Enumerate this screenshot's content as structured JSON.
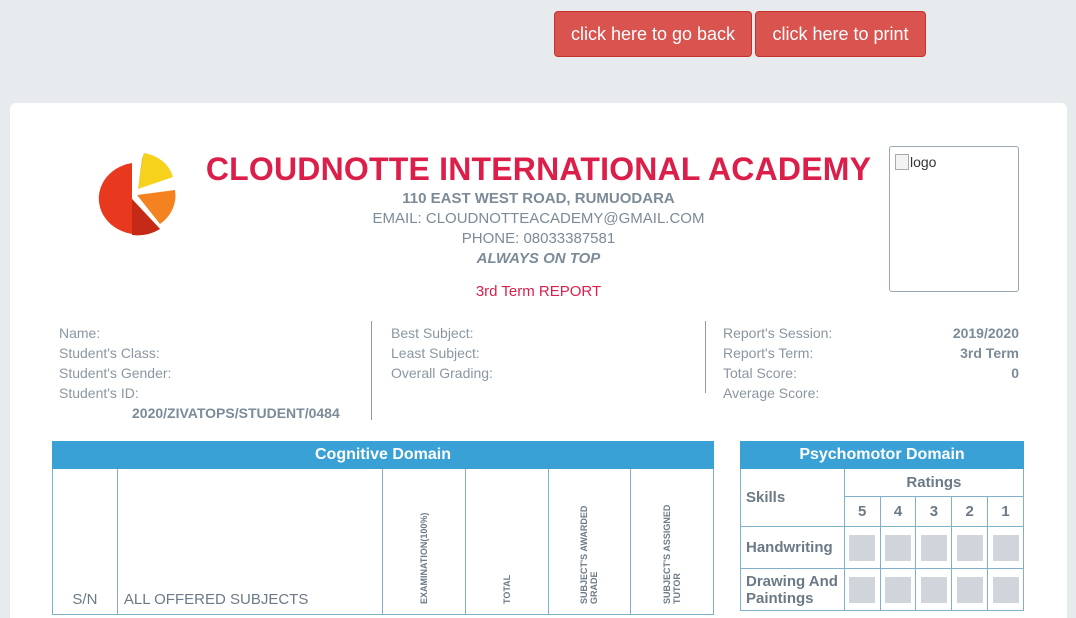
{
  "toolbar": {
    "back_label": "click here to go back",
    "print_label": "click here to print"
  },
  "header": {
    "school_name": "CLOUDNOTTE INTERNATIONAL ACADEMY",
    "address": "110 EAST WEST ROAD, RUMUODARA",
    "email": "EMAIL: CLOUDNOTTEACADEMY@GMAIL.COM",
    "phone": "PHONE: 08033387581",
    "motto": "ALWAYS ON TOP",
    "report_title": "3rd Term REPORT",
    "logo_alt": "logo"
  },
  "student": {
    "name_label": "Name:",
    "class_label": "Student's Class:",
    "gender_label": "Student's Gender:",
    "id_label": "Student's ID:",
    "id_value": "2020/ZIVATOPS/STUDENT/0484"
  },
  "grades": {
    "best_label": "Best Subject:",
    "least_label": "Least Subject:",
    "overall_label": "Overall Grading:"
  },
  "report": {
    "session_label": "Report's Session:",
    "session_value": "2019/2020",
    "term_label": "Report's Term:",
    "term_value": "3rd Term",
    "total_label": "Total Score:",
    "total_value": "0",
    "average_label": "Average Score:"
  },
  "cognitive": {
    "title": "Cognitive Domain",
    "col_sn": "S/N",
    "col_subjects": "ALL OFFERED SUBJECTS",
    "col_exam": "EXAMINATION(100%)",
    "col_total": "TOTAL",
    "col_grade": "SUBJECT'S AWARDED GRADE",
    "col_tutor": "SUBJECT'S ASSIGNED TUTOR"
  },
  "psychomotor": {
    "title": "Psychomotor Domain",
    "skills_label": "Skills",
    "ratings_label": "Ratings",
    "rating_cols": [
      "5",
      "4",
      "3",
      "2",
      "1"
    ],
    "skills": [
      {
        "name": "Handwriting"
      },
      {
        "name": "Drawing And Paintings"
      }
    ]
  },
  "colors": {
    "accent_red": "#dc1f4a",
    "button_red": "#d9534f",
    "domain_blue": "#3aa1d6"
  }
}
